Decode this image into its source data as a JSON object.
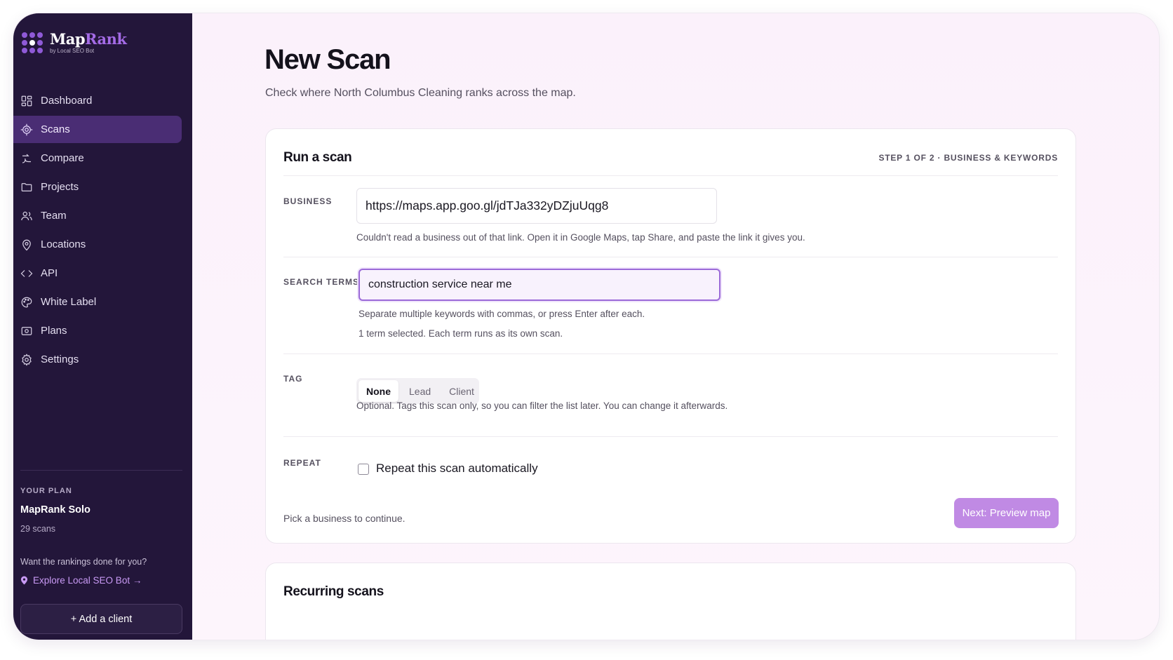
{
  "brand": {
    "name_part1": "Map",
    "name_part2": "Rank",
    "tagline": "by Local SEO Bot",
    "accent_color": "#a46be6",
    "sidebar_color": "#23163a"
  },
  "sidebar": {
    "items": [
      {
        "label": "Dashboard",
        "icon": "dashboard-icon",
        "active": false
      },
      {
        "label": "Scans",
        "icon": "target-icon",
        "active": true
      },
      {
        "label": "Compare",
        "icon": "compare-icon",
        "active": false
      },
      {
        "label": "Projects",
        "icon": "folder-icon",
        "active": false
      },
      {
        "label": "Team",
        "icon": "team-icon",
        "active": false
      },
      {
        "label": "Locations",
        "icon": "map-pin-icon",
        "active": false
      },
      {
        "label": "API",
        "icon": "code-icon",
        "active": false
      },
      {
        "label": "White Label",
        "icon": "palette-icon",
        "active": false
      },
      {
        "label": "Plans",
        "icon": "plans-icon",
        "active": false
      },
      {
        "label": "Settings",
        "icon": "gear-icon",
        "active": false
      }
    ],
    "plan": {
      "label": "YOUR PLAN",
      "name": "MapRank Solo",
      "scans": "29 scans"
    },
    "promo": {
      "question": "Want the rankings done for you?",
      "link": "Explore Local SEO Bot →"
    },
    "add_client": "+ Add a client"
  },
  "main": {
    "title": "New Scan",
    "subtitle": "Check where North Columbus Cleaning ranks across the map.",
    "card": {
      "title": "Run a scan",
      "step": "STEP 1 OF 2 · BUSINESS & KEYWORDS",
      "business": {
        "label": "BUSINESS",
        "value": "https://maps.app.goo.gl/jdTJa332yDZjuUqg8",
        "help": "Couldn't read a business out of that link. Open it in Google Maps, tap Share, and paste the link it gives you."
      },
      "search_terms": {
        "label": "SEARCH TERMS",
        "value": "construction service near me",
        "help": "Separate multiple keywords with commas, or press Enter after each.",
        "count": "1 term selected. Each term runs as its own scan."
      },
      "tag": {
        "label": "TAG",
        "options": [
          "None",
          "Lead",
          "Client"
        ],
        "selected": "None",
        "help": "Optional. Tags this scan only, so you can filter the list later. You can change it afterwards."
      },
      "repeat": {
        "label": "REPEAT",
        "checkbox_label": "Repeat this scan automatically",
        "checked": false
      },
      "footer_note": "Pick a business to continue.",
      "next_button": "Next: Preview map"
    },
    "recurring": {
      "title": "Recurring scans"
    }
  }
}
